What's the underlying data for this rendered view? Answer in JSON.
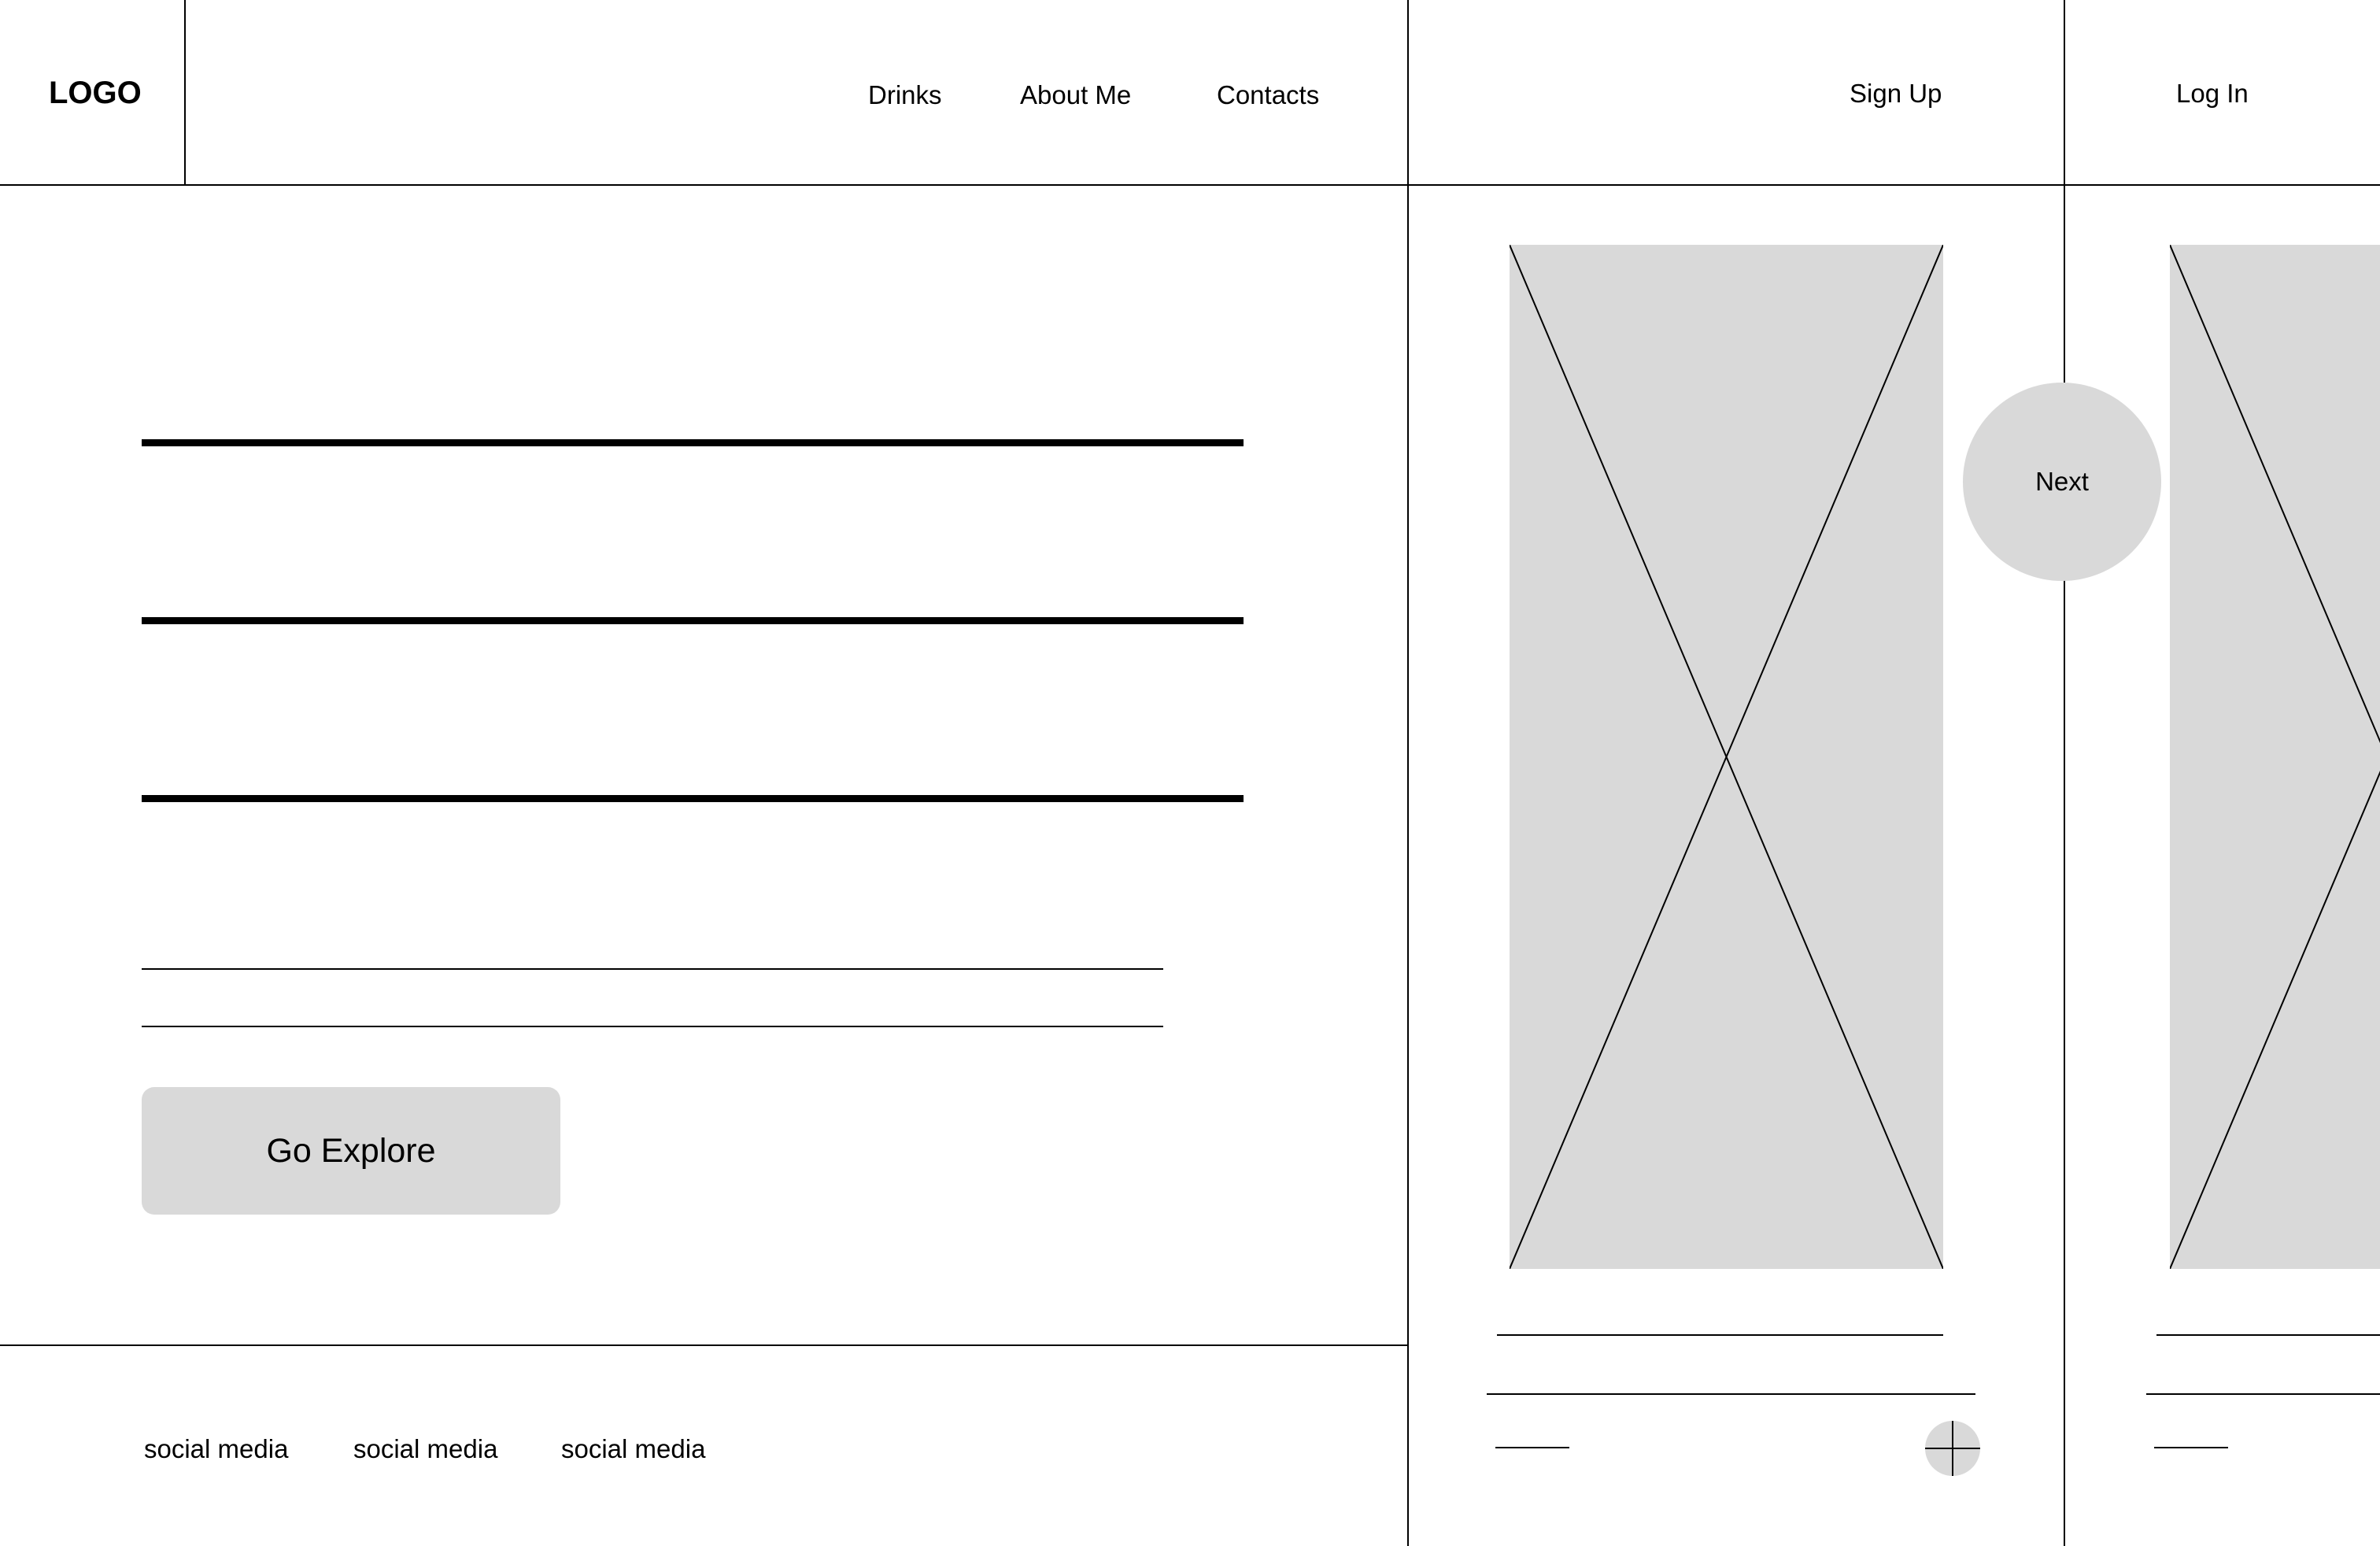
{
  "header": {
    "logo": "LOGO",
    "nav": [
      "Drinks",
      "About Me",
      "Contacts"
    ],
    "sign_up": "Sign Up",
    "log_in": "Log In"
  },
  "hero": {
    "button_label": "Go Explore"
  },
  "footer": {
    "social": [
      "social media",
      "social media",
      "social media"
    ]
  },
  "carousel": {
    "next_label": "Next",
    "card_icons": [
      "image-placeholder-icon",
      "plus-icon"
    ]
  },
  "colors": {
    "placeholder_gray": "#d9d9d9",
    "line": "#000000",
    "background": "#ffffff"
  }
}
